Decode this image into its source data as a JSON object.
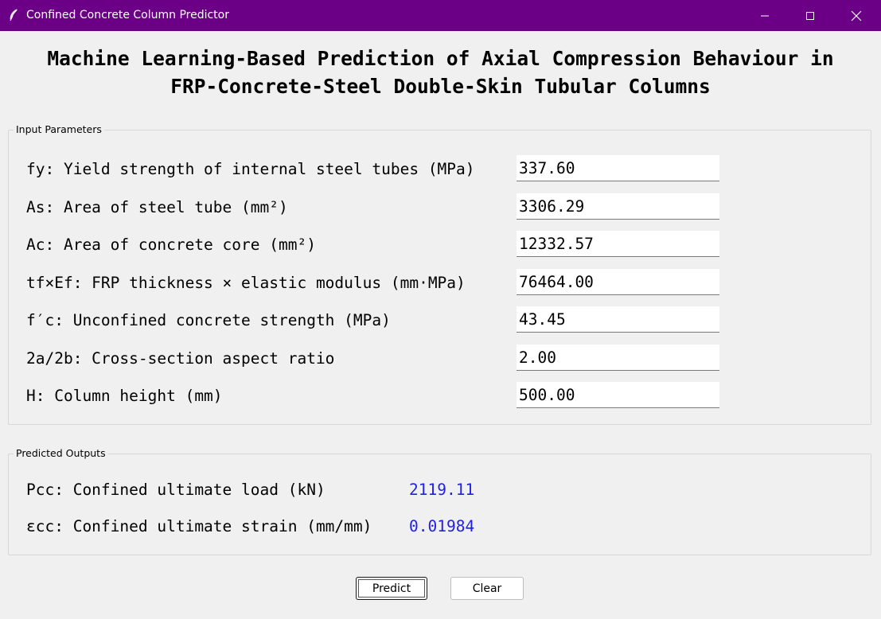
{
  "window": {
    "title": "Confined Concrete Column Predictor",
    "accent_color": "#6b0086",
    "controls": [
      "minimize-icon",
      "maximize-icon",
      "close-icon"
    ]
  },
  "headline": {
    "line1": "Machine Learning-Based Prediction of Axial Compression Behaviour in",
    "line2": "FRP-Concrete-Steel Double-Skin Tubular Columns"
  },
  "inputs": {
    "group_label": "Input Parameters",
    "fields": [
      {
        "label": "fy: Yield strength of internal steel tubes (MPa)",
        "value": "337.60"
      },
      {
        "label": "As: Area of steel tube (mm²)",
        "value": "3306.29"
      },
      {
        "label": "Ac: Area of concrete core (mm²)",
        "value": "12332.57"
      },
      {
        "label": "tf×Ef: FRP thickness × elastic modulus (mm·MPa)",
        "value": "76464.00"
      },
      {
        "label": "f′c: Unconfined concrete strength (MPa)",
        "value": "43.45"
      },
      {
        "label": "2a/2b: Cross-section aspect ratio",
        "value": "2.00"
      },
      {
        "label": "H: Column height (mm)",
        "value": "500.00"
      }
    ]
  },
  "outputs": {
    "group_label": "Predicted Outputs",
    "value_color": "#1f1fe6",
    "items": [
      {
        "label": "Pcc: Confined ultimate load (kN)",
        "value": "2119.11"
      },
      {
        "label": "εcc: Confined ultimate strain (mm/mm)",
        "value": "0.01984"
      }
    ]
  },
  "buttons": {
    "predict_label": "Predict",
    "clear_label": "Clear"
  }
}
